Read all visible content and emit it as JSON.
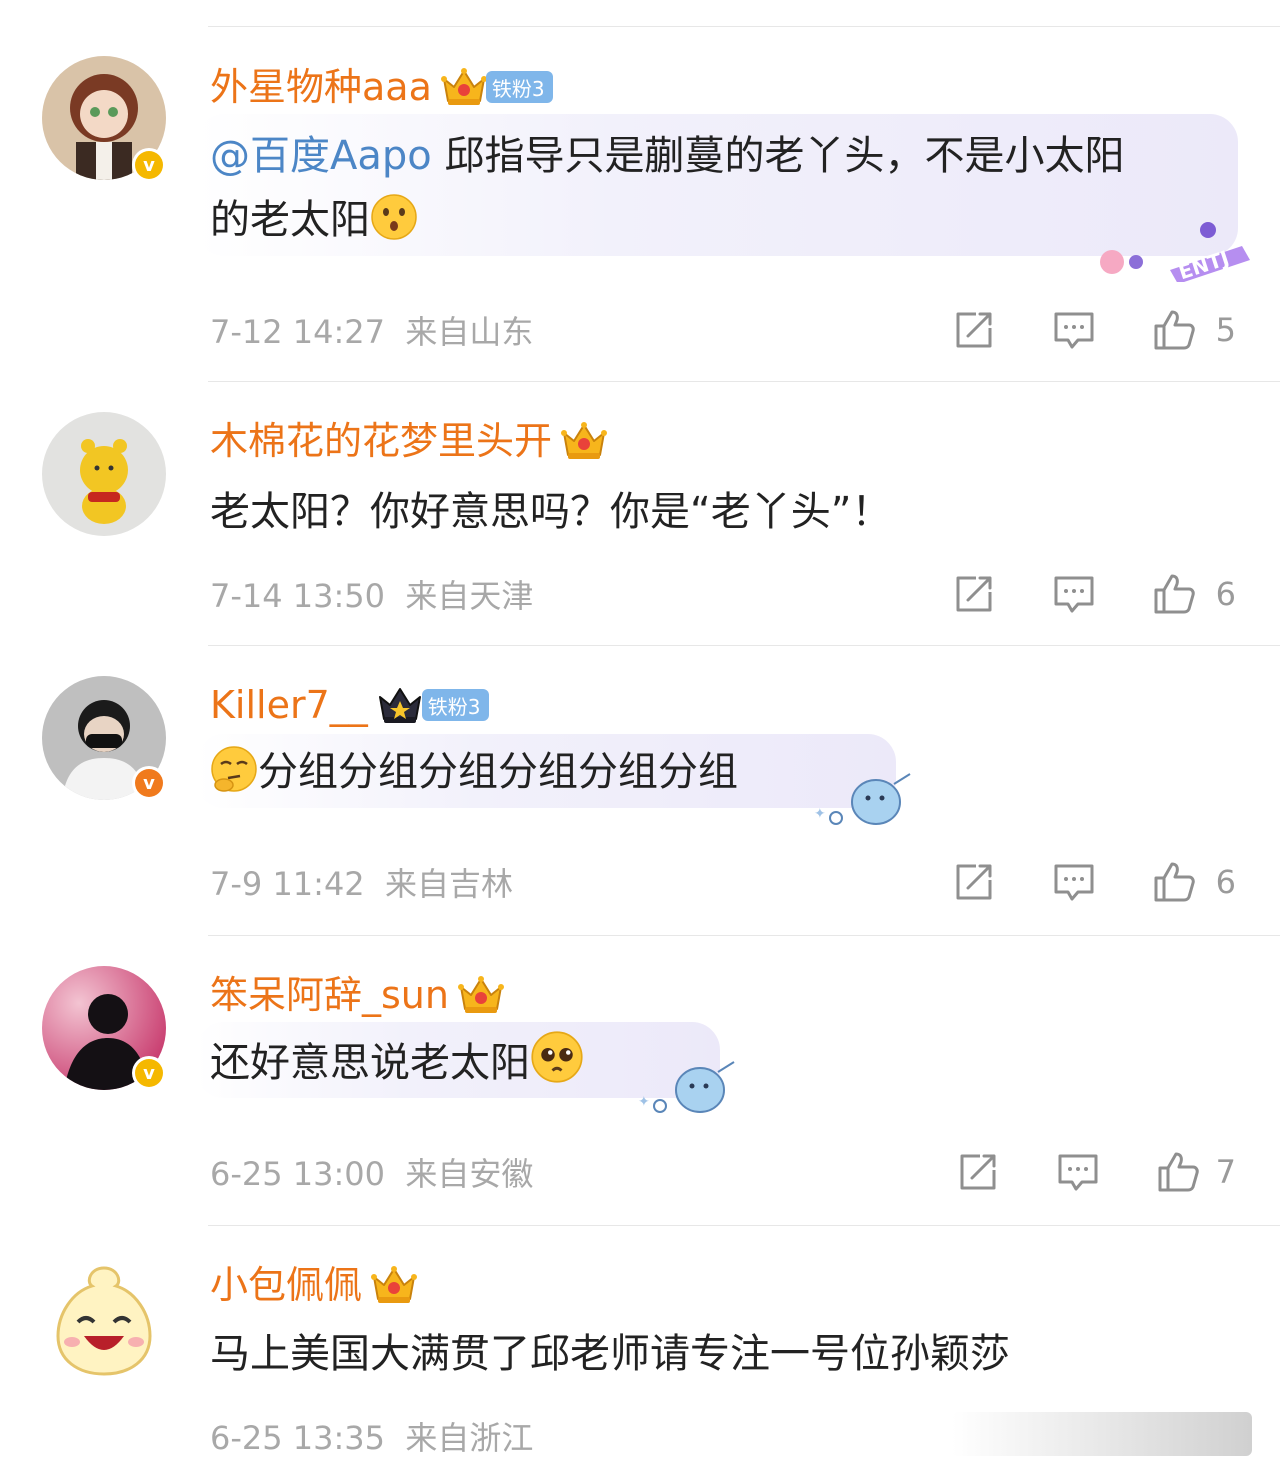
{
  "comments": [
    {
      "username": "外星物种aaa",
      "fan_badge": "铁粉3",
      "mention": "@百度Aapo",
      "text_line1": " 邱指导只是蒯蔓的老丫头，不是小太阳",
      "text_line2": "的老太阳",
      "emoji": "surprised-face-emoji",
      "time": "7-12 14:27",
      "location": "来自山东",
      "likes": "5",
      "verified": "yellow",
      "decoration": "ENTJ"
    },
    {
      "username": "木棉花的花梦里头开",
      "text": "老太阳？你好意思吗？你是“老丫头”！",
      "time": "7-14 13:50",
      "location": "来自天津",
      "likes": "6"
    },
    {
      "username": "Killer7__",
      "fan_badge": "铁粉3",
      "emoji": "thinking-face-emoji",
      "text": "分组分组分组分组分组分组",
      "time": "7-9 11:42",
      "location": "来自吉林",
      "likes": "6",
      "verified": "orange"
    },
    {
      "username": "笨呆阿辞_sun",
      "text": "还好意思说老太阳",
      "emoji": "pleading-face-emoji",
      "time": "6-25 13:00",
      "location": "来自安徽",
      "likes": "7",
      "verified": "yellow"
    },
    {
      "username": "小包佩佩",
      "text": "马上美国大满贯了邱老师请专注一号位孙颖莎",
      "time": "6-25 13:35",
      "location": "来自浙江"
    }
  ],
  "colors": {
    "username": "#ec7418",
    "mention": "#4c86c6",
    "meta": "#a8a8a8",
    "fan_badge": "#7fb6ea"
  },
  "icons": [
    "share-icon",
    "reply-icon",
    "like-icon",
    "crown-icon",
    "verified-icon"
  ]
}
